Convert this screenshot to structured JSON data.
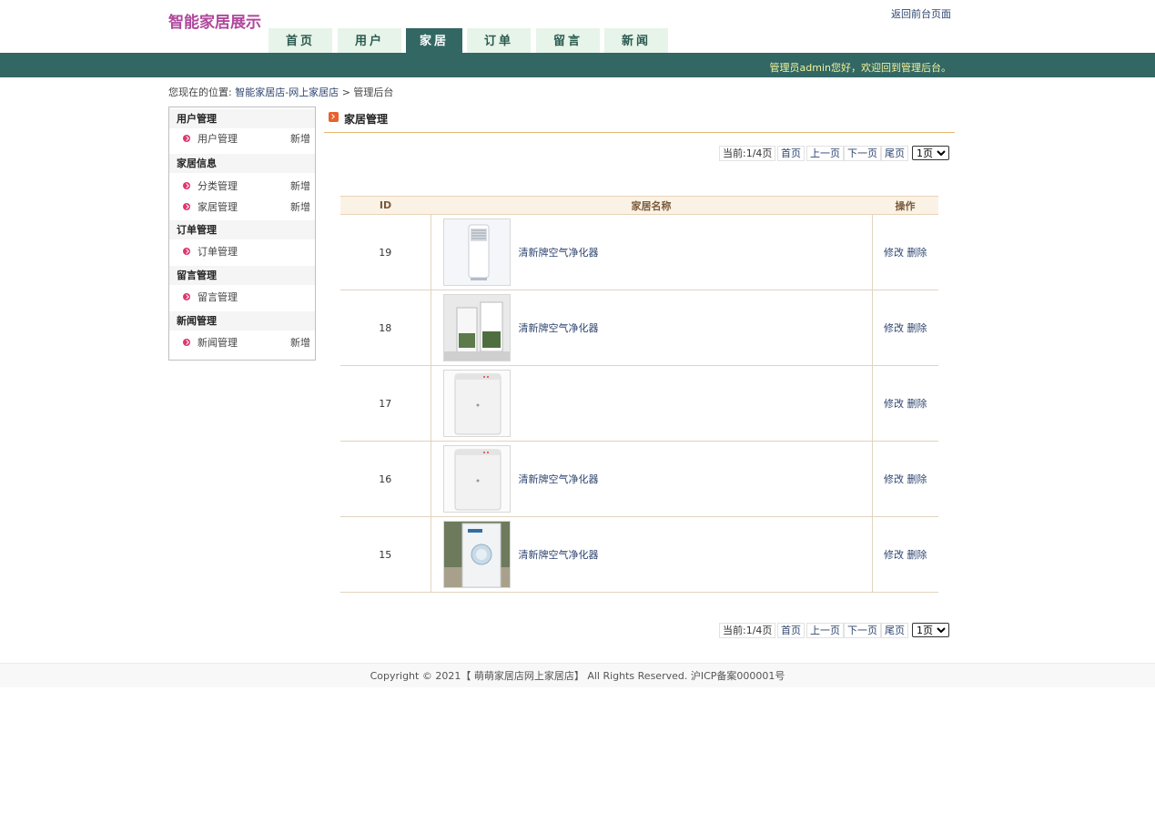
{
  "header": {
    "logo": "智能家居展示",
    "back_link": "返回前台页面",
    "welcome": "管理员admin您好，欢迎回到管理后台。"
  },
  "nav": {
    "tabs": [
      {
        "label": "首页",
        "active": false
      },
      {
        "label": "用户",
        "active": false
      },
      {
        "label": "家居",
        "active": true
      },
      {
        "label": "订单",
        "active": false
      },
      {
        "label": "留言",
        "active": false
      },
      {
        "label": "新闻",
        "active": false
      }
    ]
  },
  "breadcrumb": {
    "prefix": "您现在的位置:",
    "site": "智能家居店-网上家居店",
    "sep": ">",
    "current": "管理后台"
  },
  "sidebar": {
    "groups": [
      {
        "title": "用户管理",
        "items": [
          {
            "label": "用户管理",
            "add": "新增"
          }
        ]
      },
      {
        "title": "家居信息",
        "items": [
          {
            "label": "分类管理",
            "add": "新增"
          },
          {
            "label": "家居管理",
            "add": "新增"
          }
        ]
      },
      {
        "title": "订单管理",
        "items": [
          {
            "label": "订单管理",
            "add": ""
          }
        ]
      },
      {
        "title": "留言管理",
        "items": [
          {
            "label": "留言管理",
            "add": ""
          }
        ]
      },
      {
        "title": "新闻管理",
        "items": [
          {
            "label": "新闻管理",
            "add": "新增"
          }
        ]
      }
    ]
  },
  "section": {
    "title": "家居管理"
  },
  "pager": {
    "current": "当前:1/4页",
    "first": "首页",
    "prev": "上一页",
    "next": "下一页",
    "last": "尾页",
    "select_value": "1页"
  },
  "table": {
    "headers": {
      "id": "ID",
      "name": "家居名称",
      "ops": "操作"
    },
    "edit_label": "修改",
    "delete_label": "删除",
    "rows": [
      {
        "id": "19",
        "name": "清新牌空气净化器"
      },
      {
        "id": "18",
        "name": "清新牌空气净化器"
      },
      {
        "id": "17",
        "name": ""
      },
      {
        "id": "16",
        "name": "清新牌空气净化器"
      },
      {
        "id": "15",
        "name": "清新牌空气净化器"
      }
    ]
  },
  "footer": {
    "text": "Copyright © 2021【 萌萌家居店网上家居店】 All Rights Reserved. 沪ICP备案000001号"
  }
}
